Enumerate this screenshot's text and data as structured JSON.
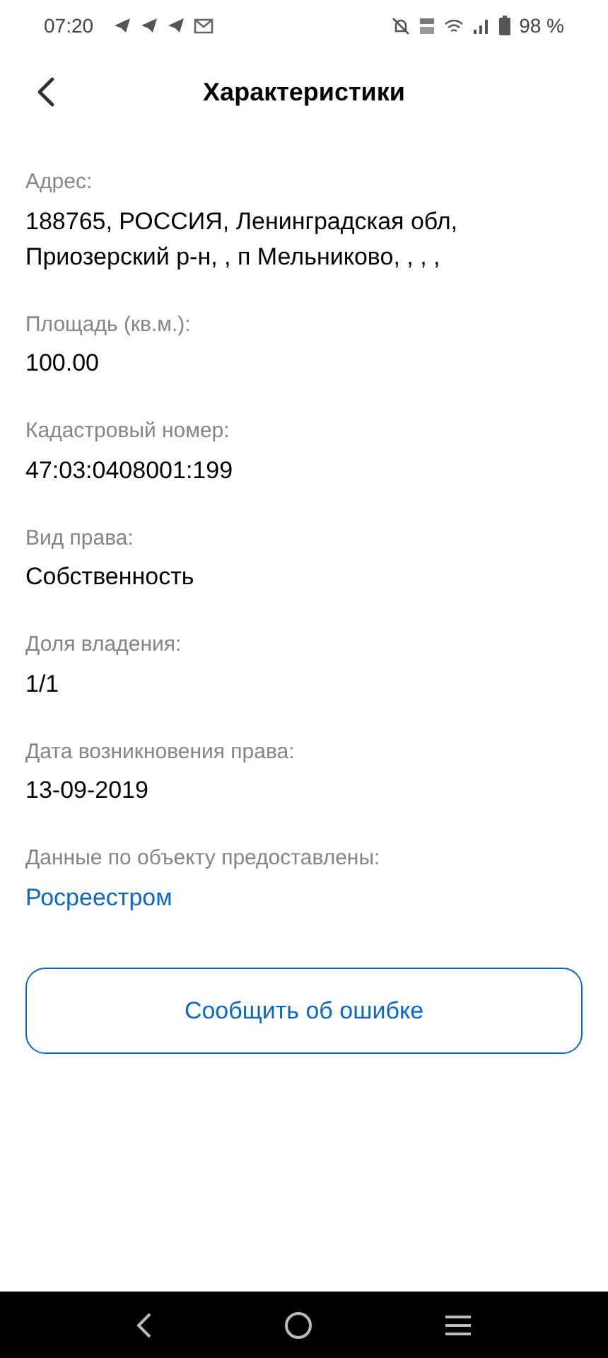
{
  "status_bar": {
    "time": "07:20",
    "battery": "98 %"
  },
  "header": {
    "title": "Характеристики"
  },
  "fields": [
    {
      "kind": "text",
      "label": "Адрес:",
      "value": "188765, РОССИЯ, Ленинградская обл, Приозерский р-н, , п Мельниково, , , ,"
    },
    {
      "kind": "text",
      "label": "Площадь (кв.м.):",
      "value": "100.00"
    },
    {
      "kind": "text",
      "label": "Кадастровый номер:",
      "value": "47:03:0408001:199"
    },
    {
      "kind": "text",
      "label": "Вид права:",
      "value": "Собственность"
    },
    {
      "kind": "text",
      "label": "Доля владения:",
      "value": "1/1"
    },
    {
      "kind": "text",
      "label": "Дата возникновения права:",
      "value": "13-09-2019"
    },
    {
      "kind": "link",
      "label": "Данные по объекту предоставлены:",
      "value": "Росреестром"
    }
  ],
  "report_button": "Сообщить об ошибке"
}
